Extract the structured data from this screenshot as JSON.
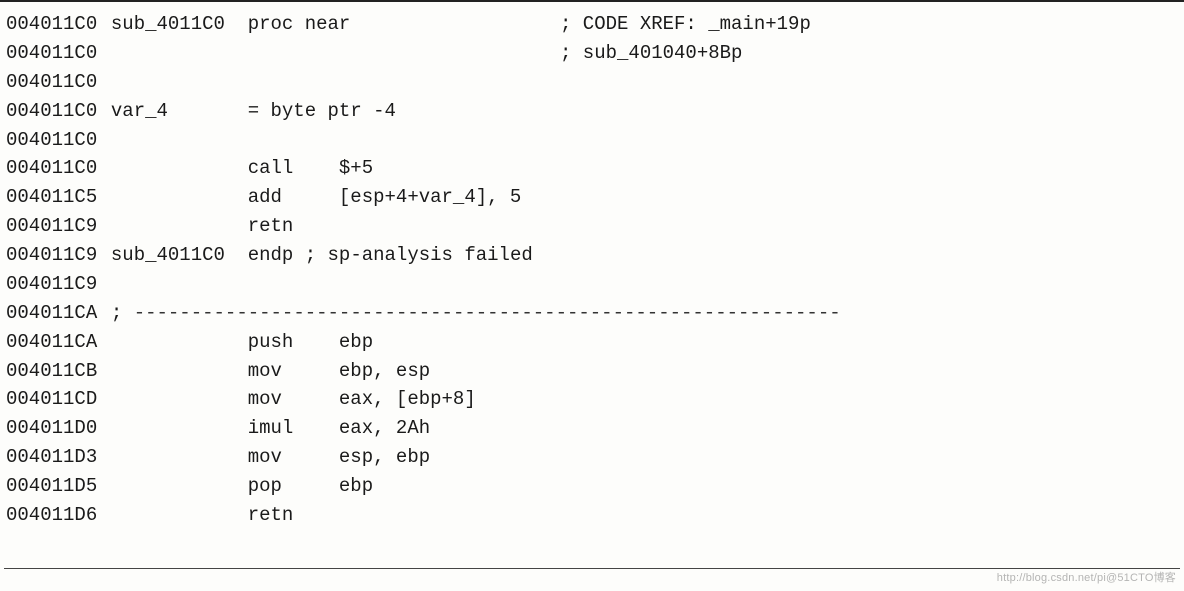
{
  "lines": [
    {
      "addr": "004011C0",
      "label": "sub_4011C0",
      "mnemonic": "proc near",
      "operand": "",
      "comment": "; CODE XREF: _main+19p"
    },
    {
      "addr": "004011C0",
      "label": "",
      "mnemonic": "",
      "operand": "",
      "comment": "; sub_401040+8Bp"
    },
    {
      "addr": "004011C0",
      "label": "",
      "mnemonic": "",
      "operand": "",
      "comment": ""
    },
    {
      "addr": "004011C0",
      "label": "var_4",
      "mnemonic": "= byte ptr -4",
      "operand": "",
      "comment": ""
    },
    {
      "addr": "004011C0",
      "label": "",
      "mnemonic": "",
      "operand": "",
      "comment": ""
    },
    {
      "addr": "004011C0",
      "label": "",
      "mnemonic": "call",
      "operand": "$+5",
      "comment": ""
    },
    {
      "addr": "004011C5",
      "label": "",
      "mnemonic": "add",
      "operand": "[esp+4+var_4], 5",
      "comment": ""
    },
    {
      "addr": "004011C9",
      "label": "",
      "mnemonic": "retn",
      "operand": "",
      "comment": ""
    },
    {
      "addr": "004011C9",
      "label": "sub_4011C0",
      "mnemonic": "endp ; sp-analysis failed",
      "operand": "",
      "comment": ""
    },
    {
      "addr": "004011C9",
      "label": "",
      "mnemonic": "",
      "operand": "",
      "comment": ""
    },
    {
      "addr": "004011CA",
      "label": ";",
      "divider": true
    },
    {
      "addr": "004011CA",
      "label": "",
      "mnemonic": "push",
      "operand": "ebp",
      "comment": ""
    },
    {
      "addr": "004011CB",
      "label": "",
      "mnemonic": "mov",
      "operand": "ebp, esp",
      "comment": ""
    },
    {
      "addr": "004011CD",
      "label": "",
      "mnemonic": "mov",
      "operand": "eax, [ebp+8]",
      "comment": ""
    },
    {
      "addr": "004011D0",
      "label": "",
      "mnemonic": "imul",
      "operand": "eax, 2Ah",
      "comment": ""
    },
    {
      "addr": "004011D3",
      "label": "",
      "mnemonic": "mov",
      "operand": "esp, ebp",
      "comment": ""
    },
    {
      "addr": "004011D5",
      "label": "",
      "mnemonic": "pop",
      "operand": "ebp",
      "comment": ""
    },
    {
      "addr": "004011D6",
      "label": "",
      "mnemonic": "retn",
      "operand": "",
      "comment": ""
    }
  ],
  "divider_dashes": "--------------------------------------------------------------",
  "watermark": "http://blog.csdn.net/pi@51CTO博客"
}
